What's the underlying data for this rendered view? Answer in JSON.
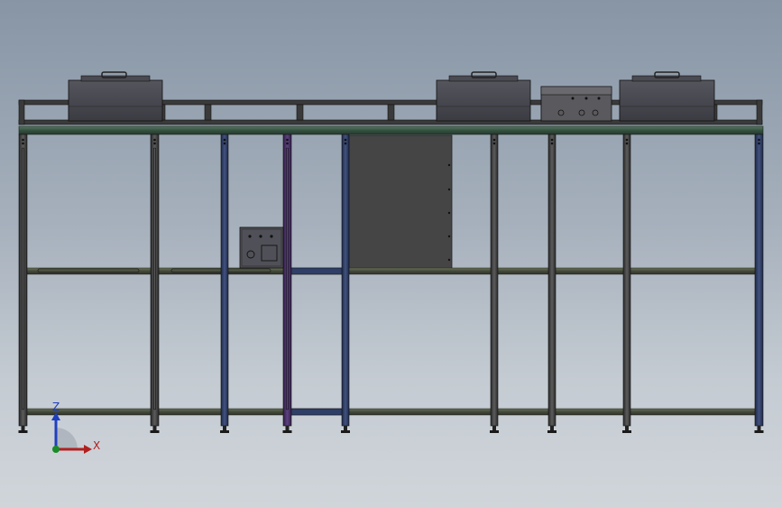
{
  "viewport": {
    "background_top": "#8795a5",
    "background_bottom": "#d0d5da"
  },
  "model": {
    "frame_color": "#3a3a3a",
    "green_rail_color": "#3b5a4a",
    "blue_post_color": "#2f3e66",
    "purple_post_color": "#4a2f66",
    "panel_color": "#454545",
    "box_color": "#4a4a52"
  },
  "triad": {
    "z_label": "Z",
    "x_label": "X",
    "z_color": "#1f3fbf",
    "x_color": "#b02020",
    "y_color": "#1a8a2a"
  }
}
